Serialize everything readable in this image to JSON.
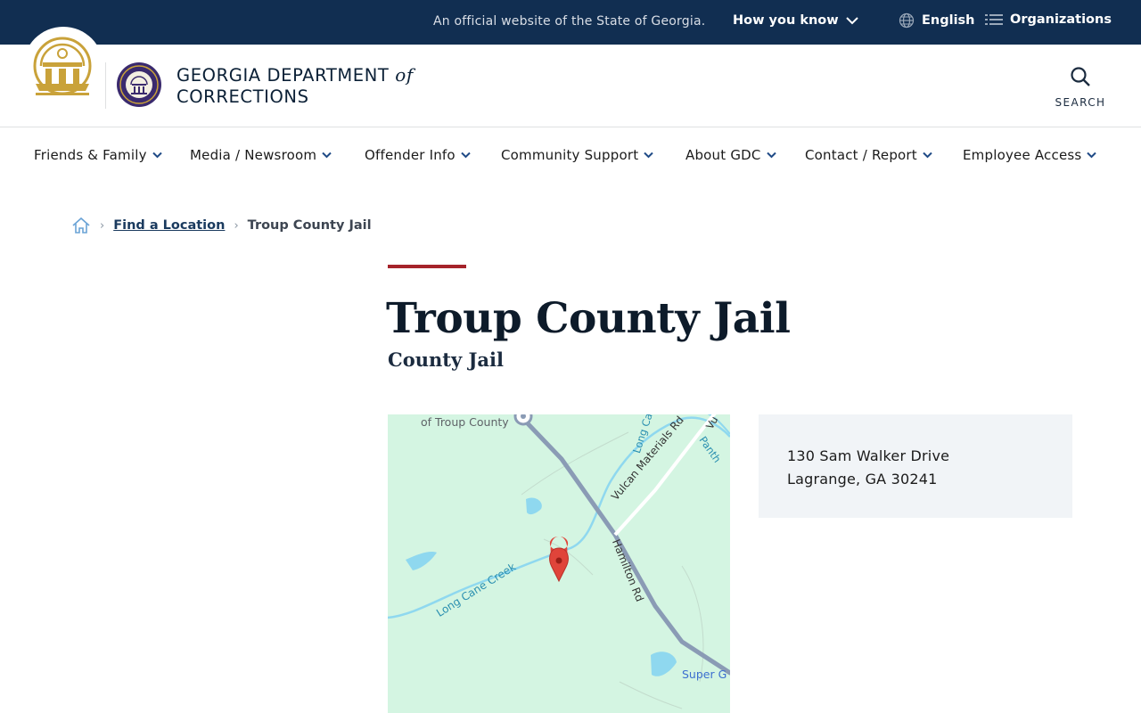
{
  "topbar": {
    "official_text": "An official website of the State of Georgia.",
    "how_you_know": "How you know",
    "language": "English",
    "organizations": "Organizations"
  },
  "header": {
    "agency_line1": "GEORGIA DEPARTMENT",
    "agency_of": "of",
    "agency_line2": "CORRECTIONS",
    "search_label": "SEARCH"
  },
  "nav": {
    "items": [
      {
        "label": "Friends & Family"
      },
      {
        "label": "Media / Newsroom"
      },
      {
        "label": "Offender Info"
      },
      {
        "label": "Community Support"
      },
      {
        "label": "About GDC"
      },
      {
        "label": "Contact / Report"
      },
      {
        "label": "Employee Access"
      }
    ]
  },
  "breadcrumb": {
    "home_icon": "home-icon",
    "link": "Find a Location",
    "current": "Troup County Jail"
  },
  "page": {
    "title": "Troup County Jail",
    "subtitle": "County Jail"
  },
  "map": {
    "labels": {
      "place": "of Troup County",
      "road1": "Vulcan Materials Rd",
      "road2": "Hamilton Rd",
      "creek": "Long Cane Creek",
      "creek2": "Long Ca",
      "partial1": "Vu",
      "partial2": "Panth",
      "business": "Super G"
    }
  },
  "address": {
    "street": "130 Sam Walker Drive",
    "city": "Lagrange, GA 30241"
  },
  "colors": {
    "topbar_bg": "#112e51",
    "accent_red": "#a5232a",
    "gold": "#c9a23a",
    "map_bg": "#d4f5e2",
    "water": "#8fd8ef",
    "road": "#8a9bb5",
    "marker": "#e0443a"
  }
}
